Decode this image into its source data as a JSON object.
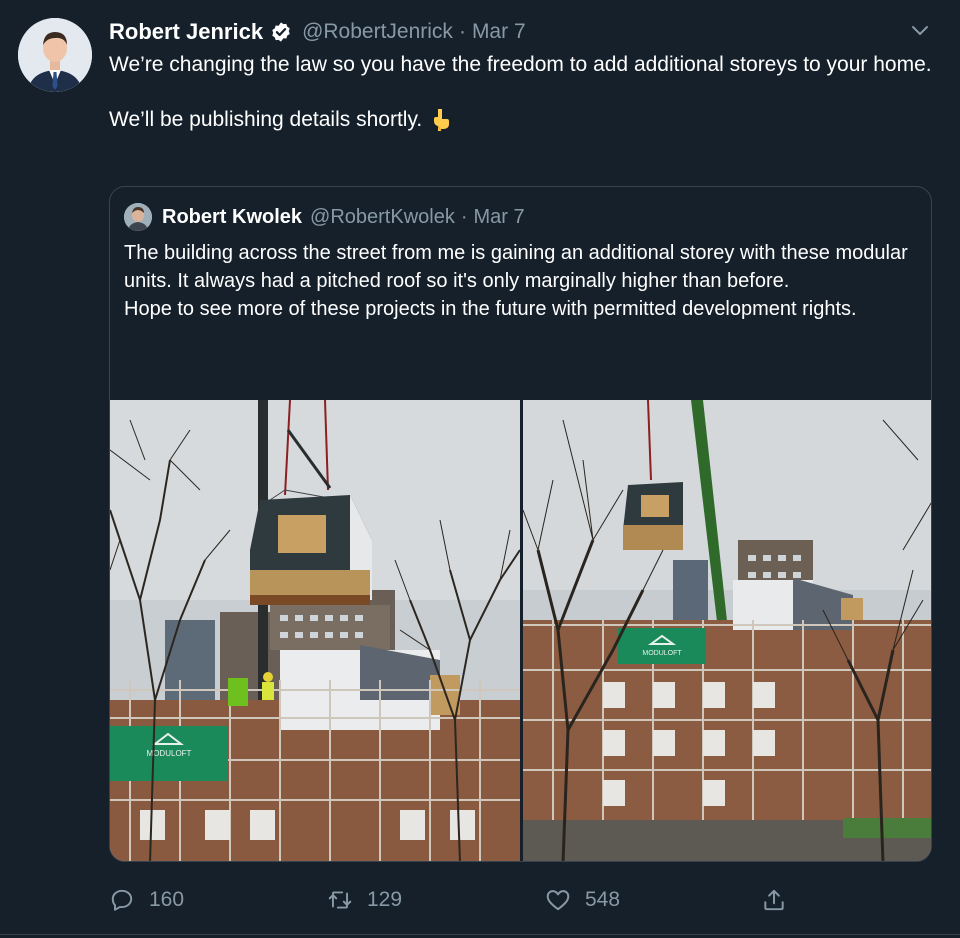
{
  "tweet": {
    "author_name": "Robert Jenrick",
    "author_handle": "@RobertJenrick",
    "separator": "·",
    "date": "Mar 7",
    "verified": true,
    "text_line1": "We’re changing the law so you have the freedom to add additional storeys to your home.",
    "text_line2": "We’ll be publishing details shortly.",
    "emoji": "backhand-index-pointing-down"
  },
  "quoted_tweet": {
    "author_name": "Robert Kwolek",
    "author_handle": "@RobertKwolek",
    "separator": "·",
    "date": "Mar 7",
    "text_para1": "The building across the street from me is gaining an additional storey with these modular units. It always had a pitched roof so it's only marginally higher than before.",
    "text_para2": "Hope to see more of these projects in the future with permitted development rights.",
    "photos": [
      {
        "name": "crane-lifting-modular-unit-photo",
        "sign_text": "MODULOFT"
      },
      {
        "name": "building-with-new-storey-photo",
        "sign_text": "MODULOFT"
      }
    ]
  },
  "actions": {
    "reply_count": "160",
    "retweet_count": "129",
    "like_count": "548"
  },
  "colors": {
    "background": "#15202b",
    "secondary_text": "#8899a6",
    "border": "#38444d",
    "verified_badge": "#ffffff"
  }
}
